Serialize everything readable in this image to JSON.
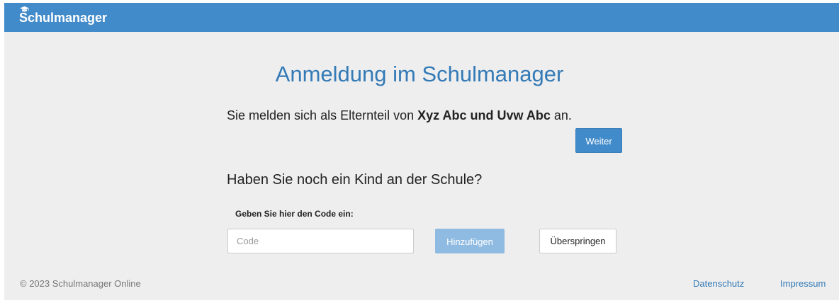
{
  "app": {
    "brand": "Schulmanager"
  },
  "page": {
    "title": "Anmeldung im Schulmanager",
    "login_prefix": "Sie melden sich als Elternteil von ",
    "login_children": "Xyz Abc und Uvw Abc",
    "login_suffix": " an.",
    "continue_label": "Weiter",
    "question": "Haben Sie noch ein Kind an der Schule?",
    "code_label": "Geben Sie hier den Code ein:",
    "code_input": {
      "value": "",
      "placeholder": "Code"
    },
    "add_label": "Hinzufügen",
    "skip_label": "Überspringen"
  },
  "footer": {
    "copyright": "© 2023 Schulmanager Online",
    "links": [
      "Datenschutz",
      "Impressum"
    ]
  },
  "colors": {
    "navbar": "#428bca",
    "title": "#337ab7",
    "background": "#eeeeee",
    "button_primary": "#428bca",
    "button_disabled": "#8fbbe2"
  },
  "icons": {
    "brand": "graduation-cap-icon"
  }
}
